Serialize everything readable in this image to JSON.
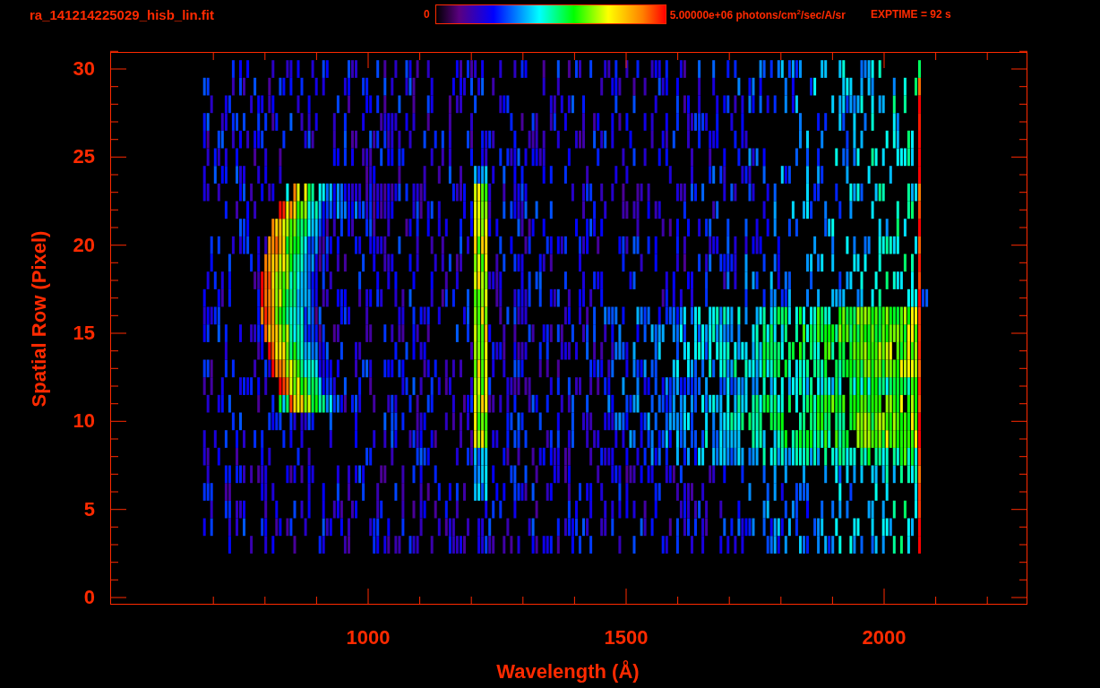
{
  "title": "ra_141214225029_hisb_lin.fit",
  "colorbar": {
    "min_label": "0",
    "max_label": "5.00000e+06 photons/cm$^{2}$/sec/A/sr"
  },
  "exposure": "EXPTIME = 92 s",
  "x_axis": {
    "label": "Wavelength (Å)",
    "ticks": [
      "1000",
      "1500",
      "2000"
    ]
  },
  "y_axis": {
    "label": "Spatial Row (Pixel)",
    "ticks": [
      "30",
      "25",
      "20",
      "15",
      "10",
      "5",
      "0"
    ]
  }
}
